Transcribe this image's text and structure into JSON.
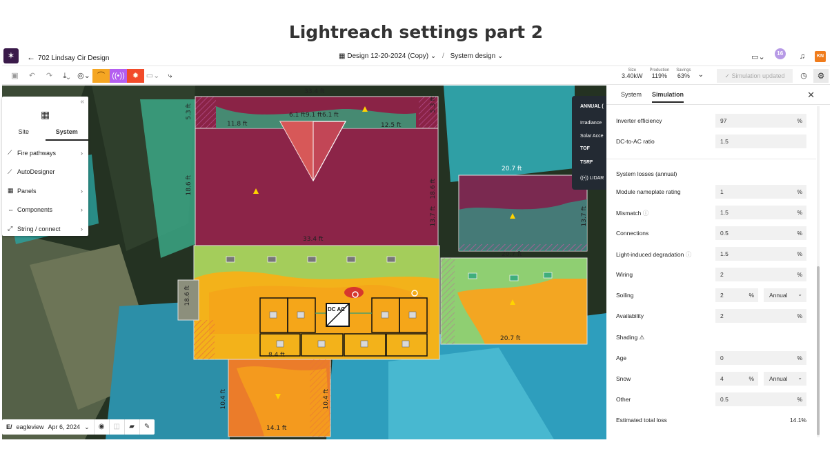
{
  "page_title": "Lightreach settings part 2",
  "header": {
    "back_label": "702 Lindsay Cir Design",
    "design_name": "Design 12-20-2024 (Copy)",
    "view_name": "System design",
    "notification_count": "16",
    "user_initials": "KN"
  },
  "toolbar": {
    "stats": [
      {
        "label": "Size",
        "value": "3.40kW"
      },
      {
        "label": "Production",
        "value": "119%"
      },
      {
        "label": "Savings",
        "value": "63%"
      }
    ],
    "simulation_status": "Simulation updated"
  },
  "left_panel": {
    "tabs": [
      "Site",
      "System"
    ],
    "active_tab": "System",
    "items": [
      {
        "label": "Fire pathways",
        "icon": "fire-pathway-icon"
      },
      {
        "label": "AutoDesigner",
        "icon": "wand-icon"
      },
      {
        "label": "Panels",
        "icon": "grid-icon"
      },
      {
        "label": "Components",
        "icon": "component-icon"
      },
      {
        "label": "String / connect",
        "icon": "string-icon"
      }
    ]
  },
  "annual_overlay": {
    "title": "ANNUAL (",
    "rows": [
      "Irradiance",
      "Solar Acce",
      "TOF",
      "TSRF"
    ],
    "lidar": "LIDAR"
  },
  "map": {
    "dimensions": [
      "33.4 ft",
      "11.8 ft",
      "12.5 ft",
      "6.1 ft",
      "9.1 ft",
      "6.1 ft",
      "5.3 ft",
      "18.6 ft",
      "13.7 ft",
      "20.7 ft",
      "33.4 ft",
      "20.7 ft",
      "18.6 ft",
      "13.7 ft",
      "20.7 ft",
      "18.6 ft",
      "14.1 ft",
      "10.4 ft",
      "10.4 ft",
      "8.4 ft",
      "5.3 ft"
    ],
    "inverter_label": "DC AC",
    "imagery_provider": "eagleview",
    "imagery_date": "Apr 6, 2024"
  },
  "right_panel": {
    "tabs": [
      "System",
      "Simulation"
    ],
    "active_tab": "Simulation",
    "inverter_efficiency": {
      "label": "Inverter efficiency",
      "value": "97",
      "unit": "%"
    },
    "dc_to_ac": {
      "label": "DC-to-AC ratio",
      "value": "1.5"
    },
    "losses_title": "System losses (annual)",
    "losses": [
      {
        "label": "Module nameplate rating",
        "value": "1",
        "unit": "%"
      },
      {
        "label": "Mismatch",
        "value": "1.5",
        "unit": "%",
        "info": true
      },
      {
        "label": "Connections",
        "value": "0.5",
        "unit": "%"
      },
      {
        "label": "Light-induced degradation",
        "value": "1.5",
        "unit": "%",
        "info": true
      },
      {
        "label": "Wiring",
        "value": "2",
        "unit": "%"
      },
      {
        "label": "Soiling",
        "value": "2",
        "unit": "%",
        "period": "Annual"
      },
      {
        "label": "Availability",
        "value": "2",
        "unit": "%"
      }
    ],
    "shading_label": "Shading",
    "other_losses": [
      {
        "label": "Age",
        "value": "0",
        "unit": "%"
      },
      {
        "label": "Snow",
        "value": "4",
        "unit": "%",
        "period": "Annual"
      },
      {
        "label": "Other",
        "value": "0.5",
        "unit": "%"
      }
    ],
    "total": {
      "label": "Estimated total loss",
      "value": "14.1%"
    }
  },
  "colors": {
    "accent_orange": "#f5a623",
    "accent_purple": "#b45ef0",
    "accent_red": "#f24b2a",
    "roof_magenta": "#8a2346",
    "roof_orange": "#f5a623"
  }
}
